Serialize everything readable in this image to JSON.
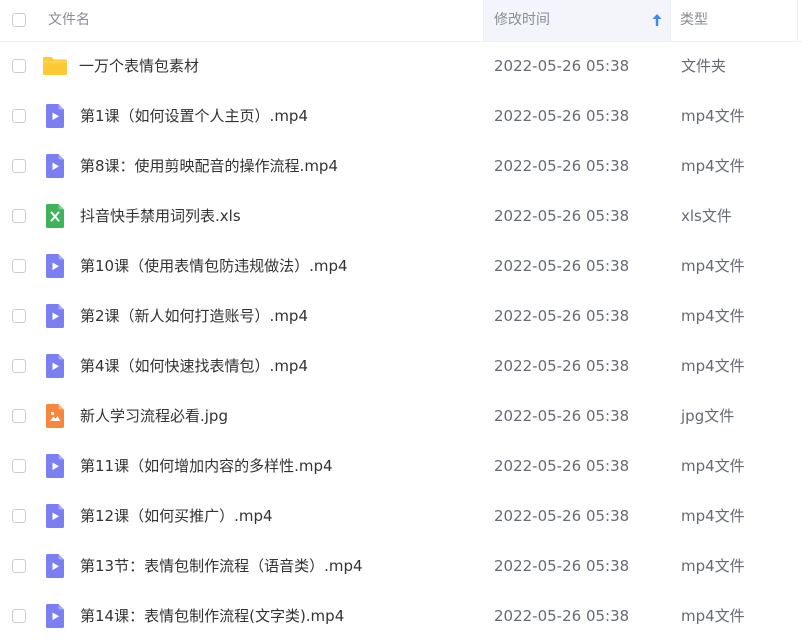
{
  "header": {
    "name_label": "文件名",
    "time_label": "修改时间",
    "type_label": "类型"
  },
  "colors": {
    "video_icon": "#7b7ff2",
    "folder_icon": "#ffc933",
    "excel_icon": "#3fb35a",
    "image_icon": "#f7863e",
    "sort_arrow": "#3d8af7"
  },
  "rows": [
    {
      "name": "一万个表情包素材",
      "time": "2022-05-26 05:38",
      "type": "文件夹",
      "icon": "folder-icon"
    },
    {
      "name": "第1课（如何设置个人主页）.mp4",
      "time": "2022-05-26 05:38",
      "type": "mp4文件",
      "icon": "video-icon"
    },
    {
      "name": "第8课：使用剪映配音的操作流程.mp4",
      "time": "2022-05-26 05:38",
      "type": "mp4文件",
      "icon": "video-icon"
    },
    {
      "name": "抖音快手禁用词列表.xls",
      "time": "2022-05-26 05:38",
      "type": "xls文件",
      "icon": "excel-icon"
    },
    {
      "name": "第10课（使用表情包防违规做法）.mp4",
      "time": "2022-05-26 05:38",
      "type": "mp4文件",
      "icon": "video-icon"
    },
    {
      "name": "第2课（新人如何打造账号）.mp4",
      "time": "2022-05-26 05:38",
      "type": "mp4文件",
      "icon": "video-icon"
    },
    {
      "name": "第4课（如何快速找表情包）.mp4",
      "time": "2022-05-26 05:38",
      "type": "mp4文件",
      "icon": "video-icon"
    },
    {
      "name": "新人学习流程必看.jpg",
      "time": "2022-05-26 05:38",
      "type": "jpg文件",
      "icon": "image-icon"
    },
    {
      "name": "第11课（如何增加内容的多样性.mp4",
      "time": "2022-05-26 05:38",
      "type": "mp4文件",
      "icon": "video-icon"
    },
    {
      "name": "第12课（如何买推广）.mp4",
      "time": "2022-05-26 05:38",
      "type": "mp4文件",
      "icon": "video-icon"
    },
    {
      "name": "第13节：表情包制作流程（语音类）.mp4",
      "time": "2022-05-26 05:38",
      "type": "mp4文件",
      "icon": "video-icon"
    },
    {
      "name": "第14课：表情包制作流程(文字类).mp4",
      "time": "2022-05-26 05:38",
      "type": "mp4文件",
      "icon": "video-icon"
    }
  ]
}
